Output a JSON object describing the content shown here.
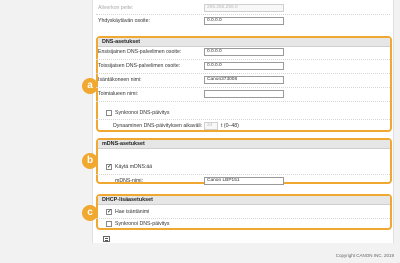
{
  "top": {
    "subnet_label": "Aliverkon peite:",
    "subnet_value": "255.255.255.0",
    "gateway_label": "Yhdyskäytävän osoite:",
    "gateway_value": "0.0.0.0"
  },
  "dns": {
    "title": "DNS-asetukset",
    "badge": "a",
    "primary_label": "Ensisijainen DNS-palvelimen osoite:",
    "primary_value": "0.0.0.0",
    "secondary_label": "Toissijaisen DNS-palvelimen osoite:",
    "secondary_value": "0.0.0.0",
    "hostname_label": "Isäntäkoneen nimi:",
    "hostname_value": "Canon373008",
    "domain_label": "Toimialueen nimi:",
    "domain_value": "",
    "dyn_update_label": "Synkronoi DNS-päivitys",
    "dyn_update_checked": false,
    "interval_label": "Dynaaminen DNS-päivityksen aikaväli:",
    "interval_value": "24",
    "interval_unit": "t (0–48)"
  },
  "mdns": {
    "title": "mDNS-asetukset",
    "badge": "b",
    "use_label": "Käytä mDNS:ää",
    "use_checked": true,
    "name_label": "mDNS-nimi:",
    "name_value": "Canon LBP151"
  },
  "dhcp": {
    "title": "DHCP-lisäasetukset",
    "badge": "c",
    "hostname_label": "Hae isäntänimi",
    "hostname_checked": true,
    "dns_update_label": "Synkronoi DNS-päivitys",
    "dns_update_checked": false
  },
  "footer": {
    "copyright": "Copyright CANON INC. 2019"
  },
  "colors": {
    "accent": "#f0a830"
  }
}
